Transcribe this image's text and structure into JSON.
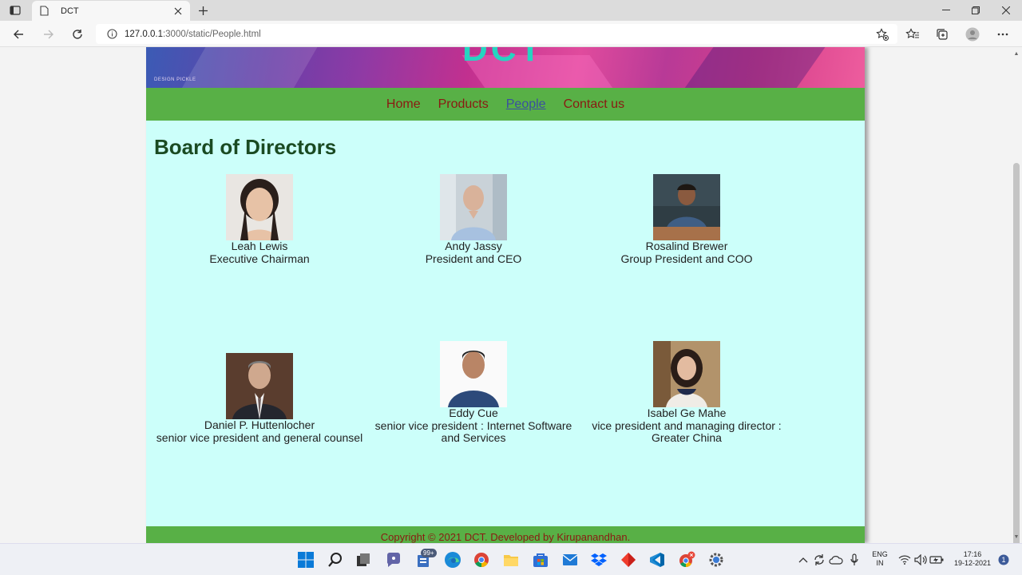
{
  "browser": {
    "tab_title": "DCT",
    "url_host": "127.0.0.1",
    "url_rest": ":3000/static/People.html"
  },
  "site": {
    "banner_logo": "DCT",
    "banner_credit": "DESIGN PICKLE",
    "nav": [
      "Home",
      "Products",
      "People",
      "Contact us"
    ],
    "active_nav": "People",
    "heading": "Board of Directors",
    "footer": "Copyright © 2021 DCT. Developed by Kirupanandhan."
  },
  "people": [
    {
      "name": "Leah Lewis",
      "title": "Executive Chairman"
    },
    {
      "name": "Andy Jassy",
      "title": "President and CEO"
    },
    {
      "name": "Rosalind Brewer",
      "title": "Group President and COO"
    },
    {
      "name": "Daniel P. Huttenlocher",
      "title": "senior vice president and general counsel"
    },
    {
      "name": "Eddy Cue",
      "title": "senior vice president : Internet Software and Services"
    },
    {
      "name": "Isabel Ge Mahe",
      "title": "vice president and managing director : Greater China"
    }
  ],
  "taskbar": {
    "store_badge": "99+",
    "lang_top": "ENG",
    "lang_bottom": "IN",
    "time": "17:16",
    "date": "19-12-2021",
    "notif_count": "1"
  }
}
